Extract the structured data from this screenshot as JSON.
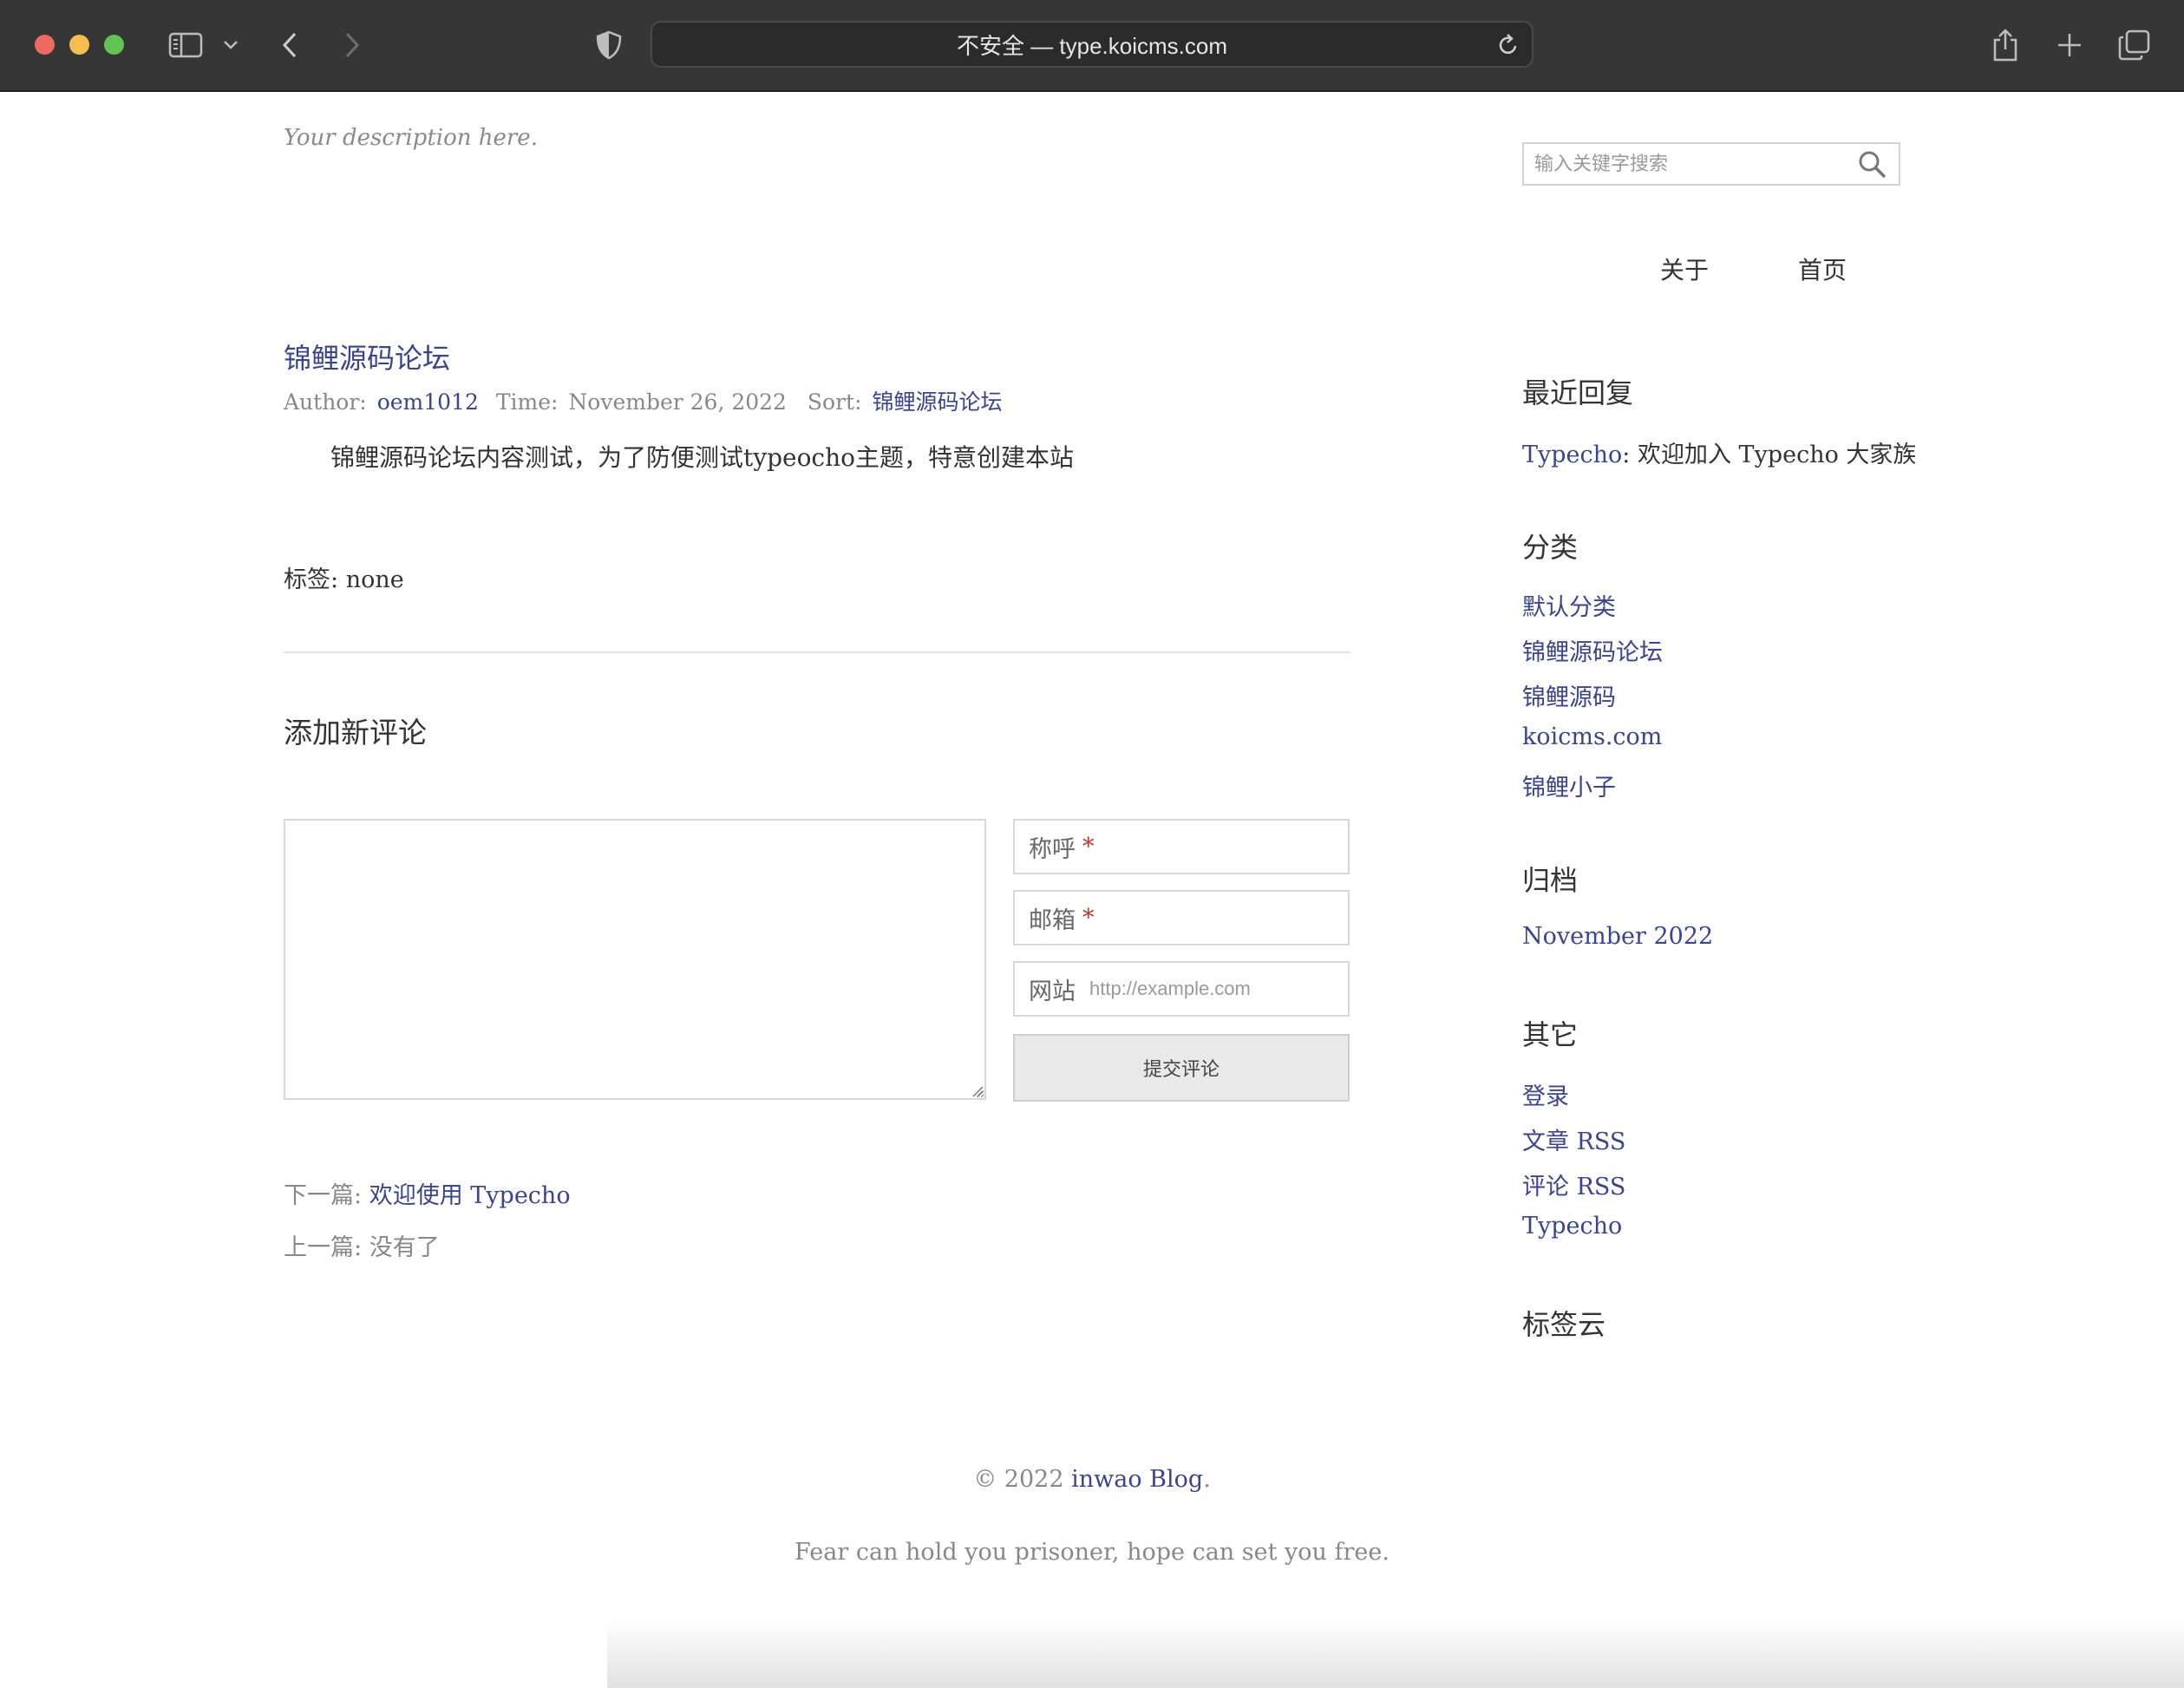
{
  "browser": {
    "url_display": "不安全 — type.koicms.com"
  },
  "site": {
    "description": "Your description here.",
    "search_placeholder": "输入关键字搜索",
    "nav": [
      "关于",
      "首页"
    ]
  },
  "post": {
    "title": "锦鲤源码论坛",
    "meta": {
      "author_label": "Author:",
      "author": "oem1012",
      "time_label": "Time:",
      "time": "November 26, 2022",
      "sort_label": "Sort:",
      "sort": "锦鲤源码论坛"
    },
    "content": "锦鲤源码论坛内容测试，为了防便测试typeocho主题，特意创建本站",
    "tags_label": "标签:",
    "tags_value": "none"
  },
  "comment_form": {
    "heading": "添加新评论",
    "name_label": "称呼",
    "email_label": "邮箱",
    "required_mark": "*",
    "website_label": "网站",
    "website_placeholder": "http://example.com",
    "submit_label": "提交评论"
  },
  "post_nav": {
    "next_label": "下一篇:",
    "next_title": "欢迎使用 Typecho",
    "prev_label": "上一篇:",
    "prev_title": "没有了"
  },
  "sidebar": {
    "recent_heading": "最近回复",
    "recent_author": "Typecho",
    "recent_text": ": 欢迎加入 Typecho 大家族",
    "categories_heading": "分类",
    "categories": [
      "默认分类",
      "锦鲤源码论坛",
      "锦鲤源码",
      "koicms.com",
      "锦鲤小子"
    ],
    "archive_heading": "归档",
    "archives": [
      "November 2022"
    ],
    "other_heading": "其它",
    "other_links": [
      "登录",
      "文章 RSS",
      "评论 RSS",
      "Typecho"
    ],
    "tagcloud_heading": "标签云"
  },
  "footer": {
    "copy_prefix": "© 2022 ",
    "blog_name": "inwao Blog",
    "copy_suffix": ".",
    "quote": "Fear can hold you prisoner, hope can set you free."
  },
  "colors": {
    "link": "#3a4490",
    "text": "#333333",
    "muted": "#888888",
    "chrome": "#363636",
    "required": "#b33b2f"
  }
}
